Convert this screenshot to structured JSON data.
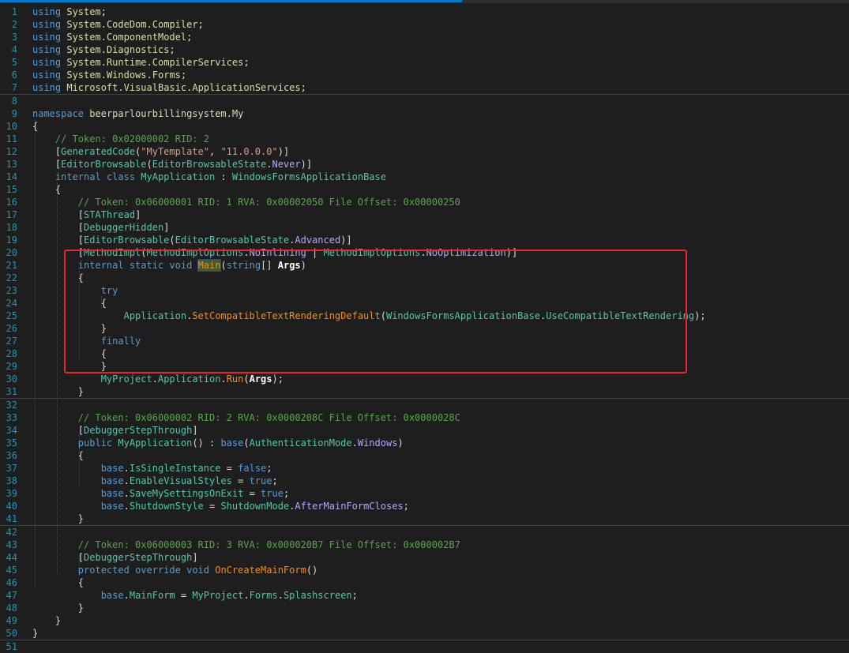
{
  "editor": {
    "lines": [
      {
        "n": "1",
        "t": "using System;"
      },
      {
        "n": "2",
        "t": "using System.CodeDom.Compiler;"
      },
      {
        "n": "3",
        "t": "using System.ComponentModel;"
      },
      {
        "n": "4",
        "t": "using System.Diagnostics;"
      },
      {
        "n": "5",
        "t": "using System.Runtime.CompilerServices;"
      },
      {
        "n": "6",
        "t": "using System.Windows.Forms;"
      },
      {
        "n": "7",
        "t": "using Microsoft.VisualBasic.ApplicationServices;"
      },
      {
        "n": "8",
        "t": ""
      },
      {
        "n": "9",
        "t": "namespace beerparlourbillingsystem.My"
      },
      {
        "n": "10",
        "t": "{"
      },
      {
        "n": "11",
        "t": "    // Token: 0x02000002 RID: 2"
      },
      {
        "n": "12",
        "t": "    [GeneratedCode(\"MyTemplate\", \"11.0.0.0\")]"
      },
      {
        "n": "13",
        "t": "    [EditorBrowsable(EditorBrowsableState.Never)]"
      },
      {
        "n": "14",
        "t": "    internal class MyApplication : WindowsFormsApplicationBase"
      },
      {
        "n": "15",
        "t": "    {"
      },
      {
        "n": "16",
        "t": "        // Token: 0x06000001 RID: 1 RVA: 0x00002050 File Offset: 0x00000250"
      },
      {
        "n": "17",
        "t": "        [STAThread]"
      },
      {
        "n": "18",
        "t": "        [DebuggerHidden]"
      },
      {
        "n": "19",
        "t": "        [EditorBrowsable(EditorBrowsableState.Advanced)]"
      },
      {
        "n": "20",
        "t": "        [MethodImpl(MethodImplOptions.NoInlining | MethodImplOptions.NoOptimization)]"
      },
      {
        "n": "21",
        "t": "        internal static void Main(string[] Args)"
      },
      {
        "n": "22",
        "t": "        {"
      },
      {
        "n": "23",
        "t": "            try"
      },
      {
        "n": "24",
        "t": "            {"
      },
      {
        "n": "25",
        "t": "                Application.SetCompatibleTextRenderingDefault(WindowsFormsApplicationBase.UseCompatibleTextRendering);"
      },
      {
        "n": "26",
        "t": "            }"
      },
      {
        "n": "27",
        "t": "            finally"
      },
      {
        "n": "28",
        "t": "            {"
      },
      {
        "n": "29",
        "t": "            }"
      },
      {
        "n": "30",
        "t": "            MyProject.Application.Run(Args);"
      },
      {
        "n": "31",
        "t": "        }"
      },
      {
        "n": "32",
        "t": ""
      },
      {
        "n": "33",
        "t": "        // Token: 0x06000002 RID: 2 RVA: 0x0000208C File Offset: 0x0000028C"
      },
      {
        "n": "34",
        "t": "        [DebuggerStepThrough]"
      },
      {
        "n": "35",
        "t": "        public MyApplication() : base(AuthenticationMode.Windows)"
      },
      {
        "n": "36",
        "t": "        {"
      },
      {
        "n": "37",
        "t": "            base.IsSingleInstance = false;"
      },
      {
        "n": "38",
        "t": "            base.EnableVisualStyles = true;"
      },
      {
        "n": "39",
        "t": "            base.SaveMySettingsOnExit = true;"
      },
      {
        "n": "40",
        "t": "            base.ShutdownStyle = ShutdownMode.AfterMainFormCloses;"
      },
      {
        "n": "41",
        "t": "        }"
      },
      {
        "n": "42",
        "t": ""
      },
      {
        "n": "43",
        "t": "        // Token: 0x06000003 RID: 3 RVA: 0x000020B7 File Offset: 0x000002B7"
      },
      {
        "n": "44",
        "t": "        [DebuggerStepThrough]"
      },
      {
        "n": "45",
        "t": "        protected override void OnCreateMainForm()"
      },
      {
        "n": "46",
        "t": "        {"
      },
      {
        "n": "47",
        "t": "            base.MainForm = MyProject.Forms.Splashscreen;"
      },
      {
        "n": "48",
        "t": "        }"
      },
      {
        "n": "49",
        "t": "    }"
      },
      {
        "n": "50",
        "t": "}"
      },
      {
        "n": "51",
        "t": ""
      }
    ]
  },
  "colors": {
    "background": "#1e1e1e",
    "line_number": "#2b91af",
    "keyword": "#569cd6",
    "type": "#4ec9b0",
    "comment": "#57a64a",
    "string": "#d69d85",
    "method": "#ff8c00",
    "enum_member": "#b8a3ff",
    "highlight_box": "#e8262b",
    "tab_accent": "#007acc"
  }
}
